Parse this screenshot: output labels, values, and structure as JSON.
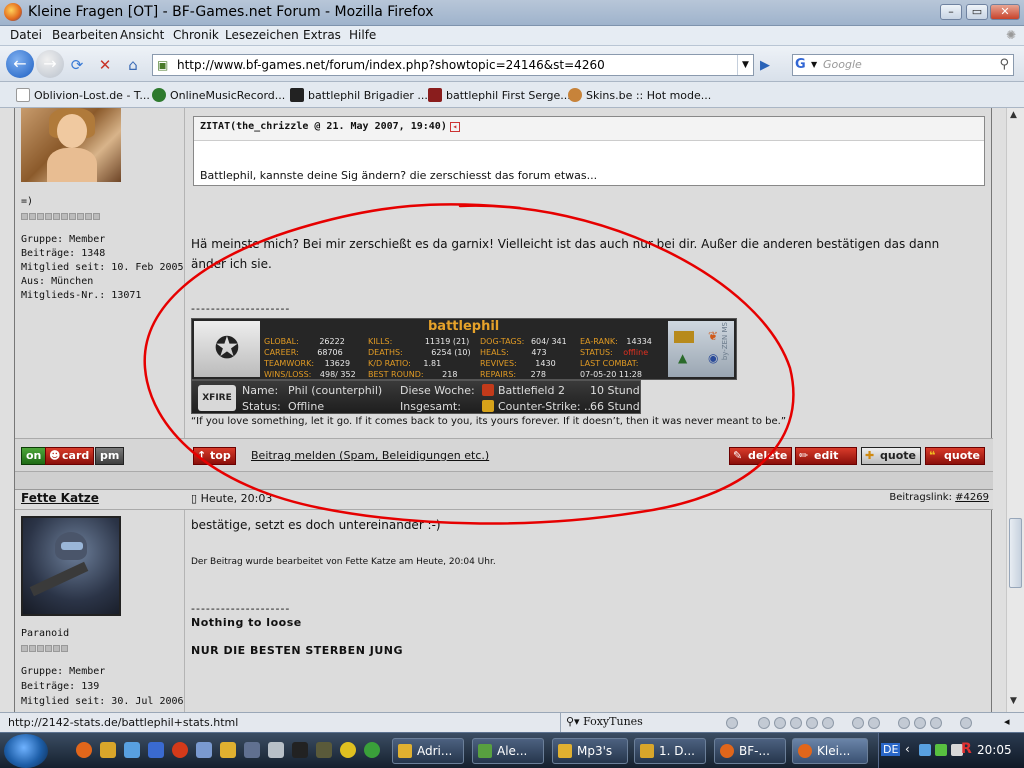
{
  "window": {
    "title": "Kleine Fragen [OT] - BF-Games.net Forum - Mozilla Firefox"
  },
  "menu": [
    "Datei",
    "Bearbeiten",
    "Ansicht",
    "Chronik",
    "Lesezeichen",
    "Extras",
    "Hilfe"
  ],
  "nav": {
    "url": "http://www.bf-games.net/forum/index.php?showtopic=24146&st=4260",
    "search_placeholder": "Google"
  },
  "bookmarks": [
    "Oblivion-Lost.de - T...",
    "OnlineMusicRecord...",
    "battlephil Brigadier ...",
    "battlephil First Serge...",
    "Skins.be :: Hot mode..."
  ],
  "post1": {
    "smiley": "=)",
    "group": "Gruppe: Member",
    "posts": "Beiträge: 1348",
    "member_since": "Mitglied seit: 10. Feb 2005",
    "from": "Aus: München",
    "member_no": "Mitglieds-Nr.: 13071",
    "quote_header": "ZITAT(the_chrizzle @ 21. May 2007, 19:40)",
    "quote_text": "Battlephil, kannste deine Sig ändern? die zerschiesst das forum etwas...",
    "text_line1": "Hä meinste mich? Bei mir zerschießt es da garnix! Vielleicht ist das auch nur bei dir. Außer die anderen bestätigen das dann",
    "text_line2": "änder ich sie.",
    "sig_divider": "--------------------",
    "motto": "“If you love something, let it go. If it comes back to you, its yours forever. If it doesn’t, then it was never meant to be.”"
  },
  "banner": {
    "name": "battlephil",
    "stats": [
      {
        "k": "GLOBAL:",
        "v": "26222"
      },
      {
        "k": "KILLS:",
        "v": "11319 (21)"
      },
      {
        "k": "DOG-TAGS:",
        "v": "604/ 341"
      },
      {
        "k": "EA-RANK:",
        "v": "14334"
      },
      {
        "k": "CAREER:",
        "v": "68706"
      },
      {
        "k": "DEATHS:",
        "v": "6254 (10)"
      },
      {
        "k": "HEALS:",
        "v": "473"
      },
      {
        "k": "STATUS:",
        "v": "offline"
      },
      {
        "k": "TEAMWORK:",
        "v": "13629"
      },
      {
        "k": "K/D RATIO:",
        "v": "1.81"
      },
      {
        "k": "REVIVES:",
        "v": "1430"
      },
      {
        "k": "LAST COMBAT:",
        "v": "07-05-20 11:28"
      },
      {
        "k": "WINS/LOSS:",
        "v": "498/ 352"
      },
      {
        "k": "BEST ROUND:",
        "v": "218"
      },
      {
        "k": "REPAIRS:",
        "v": "278"
      },
      {
        "k": "",
        "v": ""
      }
    ],
    "side": "by-ZEN MS"
  },
  "xfire": {
    "logo": "XFIRE",
    "name_label": "Name:",
    "name_value": "Phil (counterphil)",
    "status_label": "Status:",
    "status_value": "Offline",
    "week_label": "Diese Woche:",
    "week_game": "Battlefield 2",
    "week_time": "10 Stunden",
    "total_label": "Insgesamt:",
    "total_game": "Counter-Strike: ...",
    "total_time": "66 Stunden"
  },
  "actions": {
    "online": "on",
    "card": "card",
    "pm": "pm",
    "top": "top",
    "report": "Beitrag melden (Spam, Beleidigungen etc.)",
    "delete": "delete",
    "edit": "edit",
    "plusquote": "quote",
    "quote": "quote"
  },
  "post2": {
    "username": "Fette Katze",
    "date": "Heute, 20:03",
    "link_label": "Beitragslink:",
    "link_value": "#4269",
    "text": "bestätige, setzt es doch untereinander :-)",
    "edited": "Der Beitrag wurde bearbeitet von Fette Katze am Heute, 20:04 Uhr.",
    "sig_divider": "--------------------",
    "sig1": "Nothing to loose",
    "sig2": "NUR DIE BESTEN STERBEN JUNG",
    "rank": "Paranoid",
    "group": "Gruppe: Member",
    "posts": "Beiträge: 139",
    "member_since": "Mitglied seit: 30. Jul 2006"
  },
  "statusbar": {
    "text": "http://2142-stats.de/battlephil+stats.html",
    "foxytunes": "FoxyTunes"
  },
  "taskbar": {
    "tasks": [
      "Adri...",
      "Ale...",
      "Mp3's",
      "1. D...",
      "BF-...",
      "Klei..."
    ],
    "lang": "DE",
    "clock": "20:05"
  },
  "colors": {
    "annotation": "#e60000",
    "button_red": "#c62a1e",
    "banner_orange": "#e09a24"
  }
}
